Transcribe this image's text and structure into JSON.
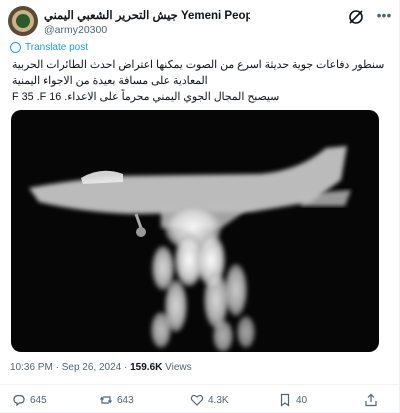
{
  "account": {
    "name": "جيش التحرير الشعبي اليمني Yemeni People's Liberati",
    "handle": "@army20300"
  },
  "icons": {
    "grok": "grok-icon",
    "more": "more-options-icon",
    "translate": "globe-icon",
    "reply": "reply-icon",
    "repost": "repost-icon",
    "like": "heart-icon",
    "bookmark": "bookmark-icon",
    "share": "share-icon"
  },
  "translate_label": "Translate post",
  "post": {
    "lines": [
      "سنطور دفاعات جوية حديثة اسرع من الصوت يمكنها اعتراض  احدث الطائرات الحربية",
      "المعادية على مسافة بعيدة من الاجواء اليمنية",
      "سيصبح المجال الجوي اليمني محرماً على الاعداء. F 35 .F 16"
    ]
  },
  "meta": {
    "time": "10:36 PM",
    "date": "Sep 26, 2024",
    "separator": "·",
    "views_count": "159.6K",
    "views_label": "Views"
  },
  "stats": {
    "replies": "645",
    "reposts": "643",
    "likes": "4.3K",
    "bookmarks": "40"
  },
  "colors": {
    "accent": "#1d9bf0",
    "secondary_text": "#536471",
    "primary_text": "#0f1419"
  }
}
